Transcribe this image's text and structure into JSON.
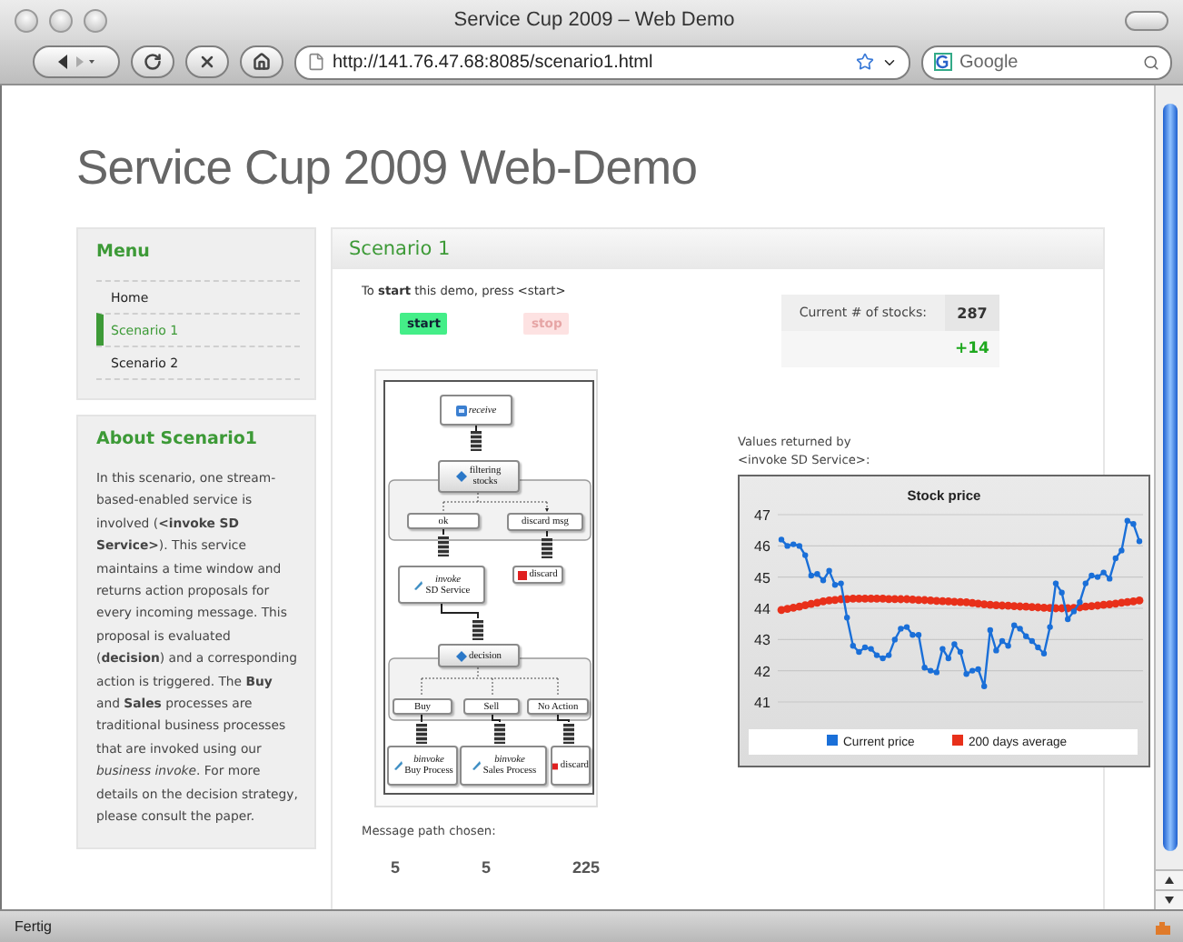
{
  "window": {
    "title": "Service Cup 2009 – Web Demo"
  },
  "toolbar": {
    "url": "http://141.76.47.68:8085/scenario1.html",
    "search": {
      "placeholder": "Google"
    }
  },
  "page": {
    "heading": "Service Cup 2009 Web-Demo",
    "menu": {
      "title": "Menu",
      "items": [
        {
          "label": "Home",
          "selected": false
        },
        {
          "label": "Scenario 1",
          "selected": true
        },
        {
          "label": "Scenario 2",
          "selected": false
        }
      ]
    },
    "about": {
      "title": "About Scenario1",
      "text": "In this scenario, one stream-based-enabled service is involved (**<invoke SD Service>**). This service maintains a time window and returns action proposals for every incoming message. This proposal is evaluated (**decision**) and a corresponding action is triggered. The **Buy** and **Sales** processes are traditional business processes that are invoked using our *business invoke*. For more details on the decision strategy, please consult the paper."
    },
    "main": {
      "title": "Scenario 1",
      "instruction": "To **start** this demo, press <start>",
      "buttons": [
        {
          "kind": "start",
          "label": "start",
          "disabled": false
        },
        {
          "kind": "stop",
          "label": "stop",
          "disabled": true
        }
      ],
      "stats": {
        "label": "Current # of stocks:",
        "value": "287",
        "delta": "+14"
      },
      "diagram": {
        "nodes": [
          {
            "kind": "receive",
            "label": "*receive*"
          },
          {
            "kind": "gateway",
            "label": "filtering\nstocks"
          },
          {
            "kind": "case",
            "label": "ok"
          },
          {
            "kind": "case",
            "label": "discard  msg"
          },
          {
            "kind": "invoke",
            "label": "*invoke*\nSD Service"
          },
          {
            "kind": "discard",
            "label": "discard"
          },
          {
            "kind": "gateway",
            "label": "decision"
          },
          {
            "kind": "case",
            "label": "Buy"
          },
          {
            "kind": "case",
            "label": "Sell"
          },
          {
            "kind": "case",
            "label": "No Action"
          },
          {
            "kind": "invoke",
            "label": "*binvoke*\nBuy Process"
          },
          {
            "kind": "invoke",
            "label": "*binvoke*\nSales Process"
          },
          {
            "kind": "discard",
            "label": "discard"
          }
        ]
      },
      "chart_caption": "Values returned by\n<invoke SD Service>:",
      "chart": {
        "chart_data": {
          "type": "line",
          "title": "Stock price",
          "grid": true,
          "legend": true,
          "ylim": [
            41,
            47
          ],
          "yticks": [
            41,
            42,
            43,
            44,
            45,
            46,
            47
          ],
          "series": [
            {
              "name": "Current price",
              "color": "#1a6fd8",
              "values": [
                46.2,
                46.0,
                46.05,
                46.0,
                45.7,
                45.05,
                45.1,
                44.9,
                45.2,
                44.75,
                44.8,
                43.7,
                42.8,
                42.6,
                42.75,
                42.7,
                42.5,
                42.4,
                42.5,
                43.0,
                43.35,
                43.4,
                43.15,
                43.15,
                42.1,
                42.0,
                41.95,
                42.7,
                42.4,
                42.85,
                42.6,
                41.9,
                42.0,
                42.05,
                41.5,
                43.3,
                42.65,
                42.95,
                42.8,
                43.45,
                43.35,
                43.1,
                42.95,
                42.75,
                42.55,
                43.4,
                44.8,
                44.5,
                43.65,
                43.9,
                44.2,
                44.8,
                45.05,
                45.0,
                45.15,
                44.95,
                45.6,
                45.85,
                46.8,
                46.7,
                46.15
              ]
            },
            {
              "name": "200 days average",
              "color": "#e8301a",
              "values": [
                43.95,
                43.98,
                44.02,
                44.05,
                44.1,
                44.14,
                44.18,
                44.22,
                44.25,
                44.27,
                44.29,
                44.3,
                44.31,
                44.31,
                44.31,
                44.31,
                44.31,
                44.31,
                44.3,
                44.3,
                44.29,
                44.29,
                44.28,
                44.27,
                44.26,
                44.25,
                44.24,
                44.23,
                44.22,
                44.21,
                44.2,
                44.19,
                44.17,
                44.15,
                44.13,
                44.11,
                44.1,
                44.09,
                44.08,
                44.07,
                44.06,
                44.05,
                44.04,
                44.03,
                44.02,
                44.01,
                44.0,
                44.0,
                44.0,
                44.01,
                44.03,
                44.05,
                44.07,
                44.09,
                44.11,
                44.13,
                44.15,
                44.18,
                44.2,
                44.22,
                44.25
              ]
            }
          ]
        }
      },
      "path": {
        "label": "Message path chosen:",
        "values": [
          "5",
          "5",
          "225"
        ]
      }
    }
  },
  "status_bar": {
    "text": "Fertig"
  }
}
